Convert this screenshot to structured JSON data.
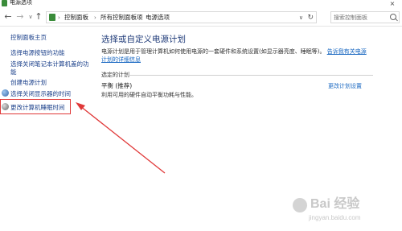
{
  "window": {
    "title": "电源选项",
    "close_glyph": "×"
  },
  "navbar": {
    "back_glyph": "←",
    "forward_glyph": "→",
    "recent_glyph": "∨",
    "up_glyph": "↑",
    "breadcrumbs": [
      "控制面板",
      "所有控制面板项",
      "电源选项"
    ],
    "separator": "›",
    "dropdown_glyph": "∨",
    "refresh_glyph": "↻",
    "search_placeholder": "搜索控制面板"
  },
  "sidebar": {
    "home": "控制面板主页",
    "items": [
      "选择电源按钮的功能",
      "选择关闭笔记本计算机盖的功能",
      "创建电源计划",
      "选择关闭显示器的时间",
      "更改计算机睡眠时间"
    ]
  },
  "main": {
    "title": "选择或自定义电源计划",
    "description": "电源计划是用于管理计算机如何使用电源的一套硬件和系统设置(如显示器亮度、睡眠等)。",
    "more_link": "告诉我有关电源计划的详细信息",
    "group_label": "选定的计划",
    "plan_name": "平衡 (推荐)",
    "plan_edit": "更改计划设置",
    "plan_description": "利用可用的硬件自动平衡功耗与性能。"
  },
  "watermark": {
    "text": "Bai 经验",
    "url": "jingyan.baidu.com"
  },
  "colors": {
    "link": "#1a3f8a",
    "accent_link": "#1565c0",
    "annotation": "#e03838"
  }
}
